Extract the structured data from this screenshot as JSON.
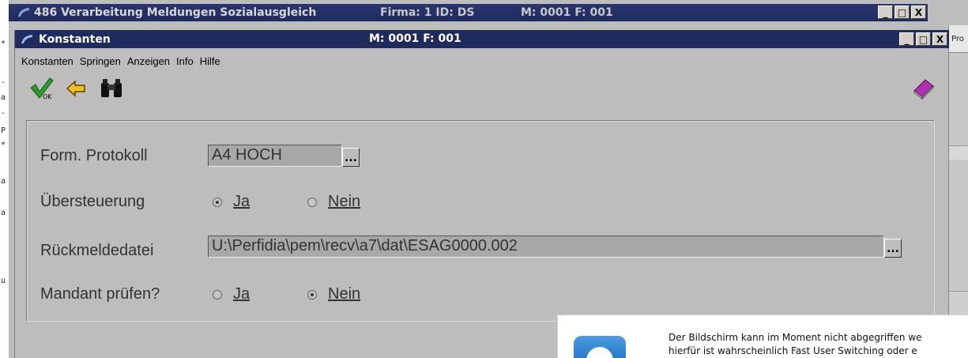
{
  "console": {
    "chars": [
      "*",
      "-",
      "a",
      "-",
      "P",
      "*",
      "a",
      "a",
      "u"
    ]
  },
  "bg_window": {
    "title": "486 Verarbeitung Meldungen Sozialausgleich",
    "firma": "Firma:  1  ID: DS",
    "mf": "M: 0001 F: 001",
    "controls": {
      "minimize": "_",
      "maximize": "□",
      "close": "X"
    },
    "right_panel_text": "Pro"
  },
  "dialog": {
    "title": "Konstanten",
    "mf": "M: 0001 F: 001",
    "controls": {
      "minimize": "_",
      "maximize": "□",
      "close": "X"
    },
    "menu": [
      "Konstanten",
      "Springen",
      "Anzeigen",
      "Info",
      "Hilfe"
    ],
    "toolbar": {
      "ok_icon": "ok-checkmark-icon",
      "back_icon": "back-arrow-icon",
      "search_icon": "binoculars-icon",
      "help_icon": "help-book-icon",
      "ok_text": "OK"
    },
    "form": {
      "protokoll_label": "Form. Protokoll",
      "protokoll_value": "A4 HOCH",
      "uebersteuerung_label": "Übersteuerung",
      "uebersteuerung_options": [
        "Ja",
        "Nein"
      ],
      "uebersteuerung_selected": "Ja",
      "rueckmelde_label": "Rückmeldedatei",
      "rueckmelde_value": "U:\\Perfidia\\pem\\recv\\a7\\dat\\ESAG0000.002",
      "mandant_label": "Mandant prüfen?",
      "mandant_options": [
        "Ja",
        "Nein"
      ],
      "mandant_selected": "Nein",
      "browse_label": "..."
    }
  },
  "popup": {
    "icon": "teamviewer-icon",
    "line1": "Der Bildschirm kann im Moment nicht abgegriffen we",
    "line2": "hierfür ist wahrscheinlich Fast User Switching oder e"
  },
  "colors": {
    "titlebar": "#1f2a5d",
    "window_bg": "#bdbdbd",
    "field_bg": "#a8a8a8"
  }
}
